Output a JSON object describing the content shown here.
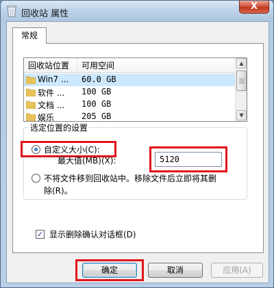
{
  "window": {
    "title": "回收站 属性",
    "close_glyph": "X",
    "accent_close": "#c7391c"
  },
  "tabs": [
    {
      "label": "常规"
    }
  ],
  "list": {
    "columns": [
      "回收站位置",
      "可用空间"
    ],
    "rows": [
      {
        "location": "Win7 ...",
        "space": "60.0 GB"
      },
      {
        "location": "软件 ...",
        "space": "100 GB"
      },
      {
        "location": "文档 ...",
        "space": "100 GB"
      },
      {
        "location": "娱乐",
        "space": "205 GB"
      }
    ]
  },
  "settings": {
    "group_label": "选定位置的设置",
    "custom_size_label": "自定义大小(C):",
    "max_label": "最大值(MB)(X):",
    "max_value": "5120",
    "no_move_label_line1": "不将文件移到回收站中。移除文件后立即将其删",
    "no_move_label_line2": "除(R)。",
    "confirm_label": "显示删除确认对话框(D)",
    "confirm_checked": true,
    "custom_size_selected": true
  },
  "buttons": {
    "ok": "确定",
    "cancel": "取消",
    "apply": "应用(A)"
  },
  "highlight_color": "#e0141b"
}
